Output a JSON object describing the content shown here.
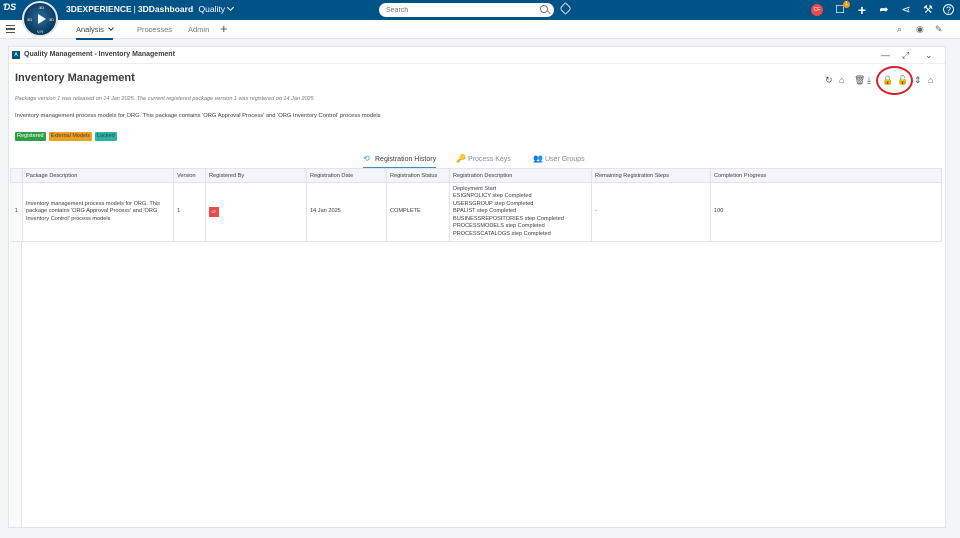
{
  "topbar": {
    "brand_prefix": "3DEXPERIENCE",
    "brand_sep": "|",
    "brand_app": "3DDashboard",
    "brand_context": "Quality",
    "search_placeholder": "Search",
    "user_initials": "CF",
    "notification_count": "1",
    "compass_labels": {
      "n": "3D",
      "w": "3D",
      "e": "3D",
      "s": "V,R"
    }
  },
  "tabbar": {
    "tabs": [
      {
        "label": "Analysis",
        "active": true
      },
      {
        "label": "Processes",
        "active": false
      },
      {
        "label": "Admin",
        "active": false
      }
    ],
    "add_label": "+"
  },
  "widget": {
    "title": "Quality Management - Inventory Management",
    "page_title": "Inventory Management",
    "package_version_text": "Package version 1 was released on 14 Jan 2025. The current registered package version 1 was registered on 14 Jan 2025",
    "package_description": "Inventory management process models for ORG. This package contains 'ORG Approval Process' and 'ORG Inventory Control' process models",
    "tags": [
      {
        "label": "Registered",
        "color": "#2f9e44"
      },
      {
        "label": "External Models",
        "color": "#f0a020"
      },
      {
        "label": "Locked",
        "color": "#2bb3a3"
      }
    ]
  },
  "record_tabs": [
    {
      "label": "Registration History",
      "icon": "history-icon",
      "active": true
    },
    {
      "label": "Process Keys",
      "icon": "key-icon",
      "active": false
    },
    {
      "label": "User Groups",
      "icon": "users-icon",
      "active": false
    }
  ],
  "table": {
    "columns": [
      "Package Description",
      "Version",
      "Registered By",
      "Registration Date",
      "Registration Status",
      "Registration Description",
      "Remaining Registration Steps",
      "Completion Progress"
    ],
    "rows": [
      {
        "index": "1",
        "package_description": "Inventory management process models for ORG. This package contains 'ORG Approval Process' and 'ORG Inventory Control' process models",
        "version": "1",
        "registered_by": "CF",
        "registration_date": "14 Jan 2025",
        "registration_status": "COMPLETE",
        "registration_description": [
          "Deployment Start",
          "ESIGNPOLICY step Completed",
          "USERSGROUP step Completed",
          "BPALIST step Completed",
          "BUSINESSREPOSITORIES step Completed",
          "PROCESSMODELS step Completed",
          "PROCESSCATALOGS step Completed"
        ],
        "remaining_steps": "-",
        "completion_progress": "100"
      }
    ]
  }
}
